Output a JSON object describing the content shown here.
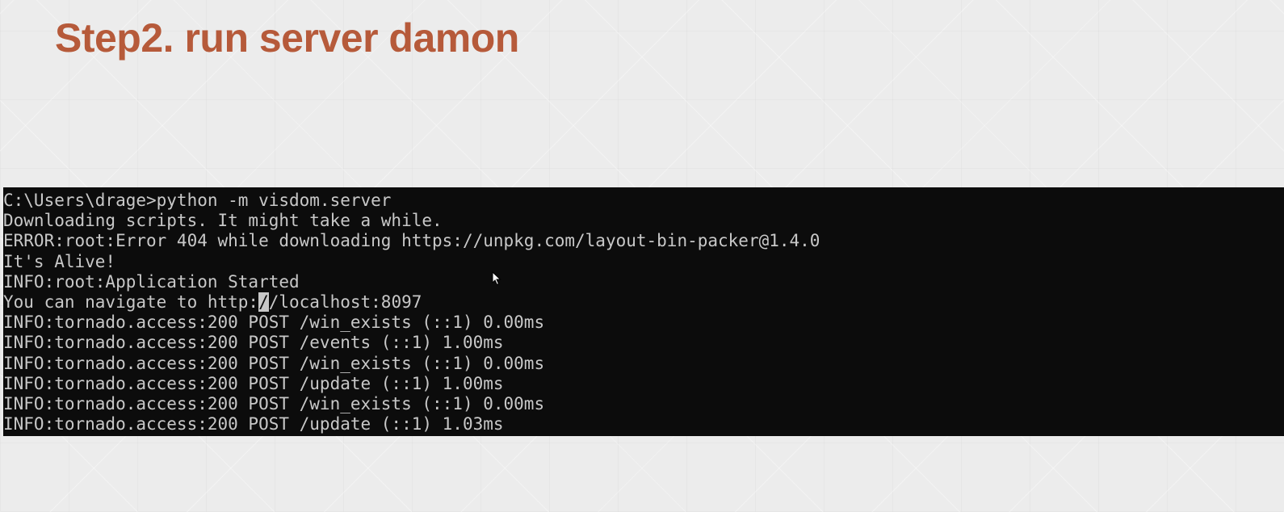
{
  "slide": {
    "title": "Step2. run server damon"
  },
  "console": {
    "line_1": "C:\\Users\\drage>python -m visdom.server",
    "line_2": "Downloading scripts. It might take a while.",
    "line_3": "ERROR:root:Error 404 while downloading https://unpkg.com/layout-bin-packer@1.4.0",
    "line_4": "It's Alive!",
    "line_5": "INFO:root:Application Started",
    "line_6_before_cursor": "You can navigate to http:",
    "line_6_cursor_char": "/",
    "line_6_after_cursor": "/localhost:8097",
    "line_7": "INFO:tornado.access:200 POST /win_exists (::1) 0.00ms",
    "line_8": "INFO:tornado.access:200 POST /events (::1) 1.00ms",
    "line_9": "INFO:tornado.access:200 POST /win_exists (::1) 0.00ms",
    "line_10": "INFO:tornado.access:200 POST /update (::1) 1.00ms",
    "line_11": "INFO:tornado.access:200 POST /win_exists (::1) 0.00ms",
    "line_12": "INFO:tornado.access:200 POST /update (::1) 1.03ms"
  },
  "colors": {
    "title": "#b65a3a",
    "console_background": "#0c0c0c",
    "console_text": "#c8c8c8"
  },
  "icons": {
    "mouse_pointer": "mouse-pointer-icon"
  }
}
